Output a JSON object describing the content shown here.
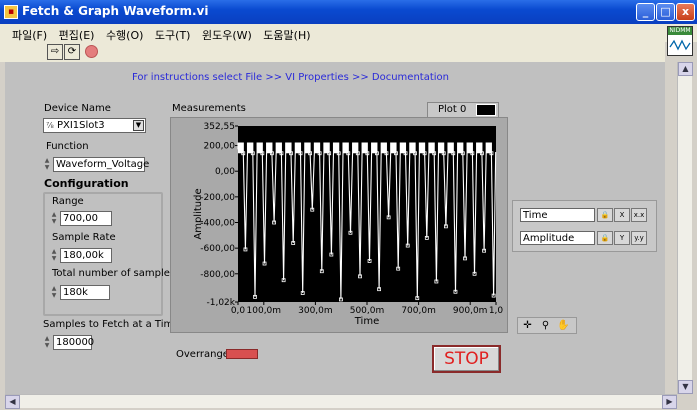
{
  "window": {
    "title": "Fetch & Graph Waveform.vi",
    "min": "_",
    "max": "□",
    "close": "x"
  },
  "menu": [
    "파일(F)",
    "편집(E)",
    "수행(O)",
    "도구(T)",
    "윈도우(W)",
    "도움말(H)"
  ],
  "vi_icon_label": "NIDMM",
  "instructions": "For instructions select File >> VI Properties >> Documentation",
  "device": {
    "label": "Device Name",
    "value": "PXI1Slot3"
  },
  "function": {
    "label": "Function",
    "value": "Waveform_Voltage"
  },
  "configuration": {
    "label": "Configuration",
    "range_label": "Range",
    "range_value": "700,00",
    "rate_label": "Sample Rate",
    "rate_value": "180,00k",
    "total_label": "Total number of samples",
    "total_value": "180k"
  },
  "fetch": {
    "label": "Samples to Fetch at a Time",
    "value": "180000"
  },
  "overrange_label": "Overrange",
  "stop_label": "STOP",
  "graph": {
    "caption": "Measurements",
    "legend": "Plot 0",
    "x_name": "Time",
    "y_name": "Amplitude",
    "palette_icons": [
      "crosshair-icon",
      "zoom-icon",
      "hand-icon"
    ]
  },
  "chart_data": {
    "type": "line",
    "title": "Measurements",
    "xlabel": "Time",
    "ylabel": "Amplitude",
    "xlim": [
      0,
      1.0
    ],
    "ylim": [
      -1020,
      352.55
    ],
    "x_ticks": [
      "0,0",
      "100,0m",
      "300,0m",
      "500,0m",
      "700,0m",
      "900,0m",
      "1,0"
    ],
    "x_tick_values": [
      0,
      0.1,
      0.3,
      0.5,
      0.7,
      0.9,
      1.0
    ],
    "y_ticks": [
      "352,55",
      "200,00",
      "0,00",
      "-200,00",
      "-400,00",
      "-600,00",
      "-800,00",
      "-1,02k"
    ],
    "y_tick_values": [
      352.55,
      200,
      0,
      -200,
      -400,
      -600,
      -800,
      -1020
    ],
    "background": "#000000",
    "line_color": "#ffffff",
    "series": [
      {
        "name": "Plot 0",
        "period": 0.037,
        "high": 180,
        "low_values": [
          -610,
          -980,
          -720,
          -400,
          -850,
          -560,
          -950,
          -300,
          -780,
          -650,
          -1000,
          -480,
          -820,
          -700,
          -920,
          -360,
          -760,
          -580,
          -990,
          -520,
          -860,
          -430,
          -940,
          -680,
          -800,
          -620,
          -970
        ]
      }
    ]
  }
}
